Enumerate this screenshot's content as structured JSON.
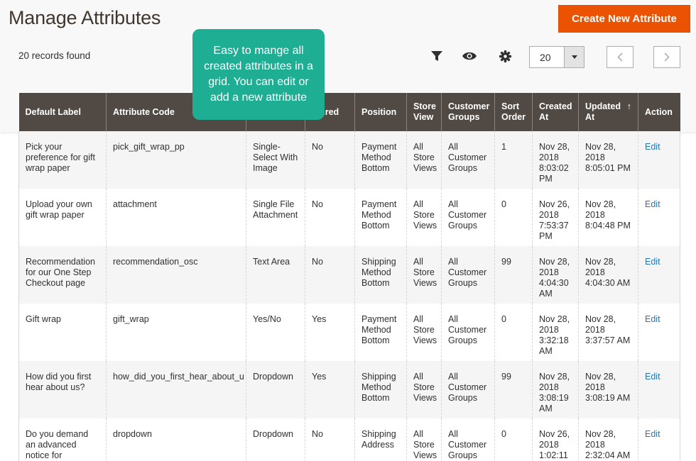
{
  "header": {
    "title": "Manage Attributes",
    "create_button": "Create New Attribute"
  },
  "toolbar": {
    "records_found": "20 records found",
    "filter_icon": "filter-icon",
    "columns_icon": "eye-icon",
    "settings_icon": "gear-icon",
    "per_page_value": "20",
    "prev_icon": "chevron-left-icon",
    "next_icon": "chevron-right-icon"
  },
  "tooltip": {
    "text": "Easy to mange all created attributes in a grid. You can edit or add a new attribute"
  },
  "colors": {
    "accent": "#eb5202",
    "header_bg": "#514943",
    "tooltip_bg": "#1dae94",
    "link": "#1979c3"
  },
  "table": {
    "columns": [
      {
        "label": "Default Label"
      },
      {
        "label": "Attribute Code"
      },
      {
        "label": ""
      },
      {
        "label": "quired"
      },
      {
        "label": "Position"
      },
      {
        "label": "Store View"
      },
      {
        "label": "Customer Groups"
      },
      {
        "label": "Sort Order"
      },
      {
        "label": "Created At"
      },
      {
        "label": "Updated At",
        "sort": "↑"
      },
      {
        "label": "Action"
      }
    ],
    "rows": [
      {
        "label": "Pick your preference for gift wrap paper",
        "code": "pick_gift_wrap_pp",
        "type": "Single-Select With Image",
        "required": "No",
        "position": "Payment Method Bottom",
        "store_view": "All Store Views",
        "groups": "All Customer Groups",
        "sort": "1",
        "created": "Nov 28, 2018 8:03:02 PM",
        "updated": "Nov 28, 2018 8:05:01 PM",
        "action": "Edit"
      },
      {
        "label": "Upload your own gift wrap paper",
        "code": "attachment",
        "type": "Single File Attachment",
        "required": "No",
        "position": "Payment Method Bottom",
        "store_view": "All Store Views",
        "groups": "All Customer Groups",
        "sort": "0",
        "created": "Nov 26, 2018 7:53:37 PM",
        "updated": "Nov 28, 2018 8:04:48 PM",
        "action": "Edit"
      },
      {
        "label": "Recommendation for our One Step Checkout page",
        "code": "recommendation_osc",
        "type": "Text Area",
        "required": "No",
        "position": "Shipping Method Bottom",
        "store_view": "All Store Views",
        "groups": "All Customer Groups",
        "sort": "99",
        "created": "Nov 28, 2018 4:04:30 AM",
        "updated": "Nov 28, 2018 4:04:30 AM",
        "action": "Edit"
      },
      {
        "label": "Gift wrap",
        "code": "gift_wrap",
        "type": "Yes/No",
        "required": "Yes",
        "position": "Payment Method Bottom",
        "store_view": "All Store Views",
        "groups": "All Customer Groups",
        "sort": "0",
        "created": "Nov 28, 2018 3:32:18 AM",
        "updated": "Nov 28, 2018 3:37:57 AM",
        "action": "Edit"
      },
      {
        "label": "How did you first hear about us?",
        "code": "how_did_you_first_hear_about_u",
        "type": "Dropdown",
        "required": "Yes",
        "position": "Shipping Method Bottom",
        "store_view": "All Store Views",
        "groups": "All Customer Groups",
        "sort": "99",
        "created": "Nov 28, 2018 3:08:19 AM",
        "updated": "Nov 28, 2018 3:08:19 AM",
        "action": "Edit"
      },
      {
        "label": "Do you demand an advanced notice for shipping?",
        "code": "dropdown",
        "type": "Dropdown",
        "required": "No",
        "position": "Shipping Address",
        "store_view": "All Store Views",
        "groups": "All Customer Groups",
        "sort": "0",
        "created": "Nov 26, 2018 1:02:11",
        "updated": "Nov 28, 2018 2:32:04 AM",
        "action": "Edit"
      }
    ]
  }
}
